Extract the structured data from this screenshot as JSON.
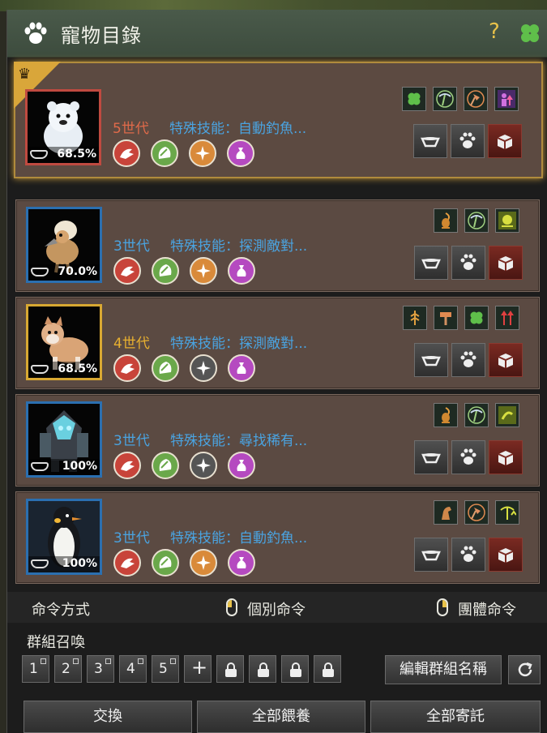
{
  "window": {
    "title": "寵物目錄",
    "help": "?"
  },
  "pets": [
    {
      "generation": "5世代",
      "gen_color": "#e06a4a",
      "skill": "特殊技能：自動釣魚...",
      "feed": "68.5%",
      "frame": "red",
      "leader": true,
      "pet_icon": "polar-bear-icon",
      "commands": [
        "#c8443a",
        "#6aa84a",
        "#d98a3a",
        "#b54ac0"
      ],
      "buffs": [
        "clover-icon",
        "pickaxe-icon",
        "axe-icon",
        "up-arrow-icon"
      ]
    },
    {
      "generation": "3世代",
      "gen_color": "#4aa3e0",
      "skill": "特殊技能：探測敵對...",
      "feed": "70.0%",
      "frame": "blue",
      "leader": false,
      "pet_icon": "hatchling-bird-icon",
      "commands": [
        "#c8443a",
        "#6aa84a",
        "#d98a3a",
        "#b54ac0"
      ],
      "buffs": [
        "scorpion-icon",
        "pickaxe-icon",
        "speed-icon"
      ]
    },
    {
      "generation": "4世代",
      "gen_color": "#e8b030",
      "skill": "特殊技能：探測敵對...",
      "feed": "68.5%",
      "frame": "gold",
      "leader": false,
      "pet_icon": "shiba-dog-icon",
      "commands": [
        "#c8443a",
        "#6aa84a",
        "#555555",
        "#b54ac0"
      ],
      "buffs": [
        "wheat-icon",
        "hammer-icon",
        "clover-icon",
        "double-arrow-icon"
      ]
    },
    {
      "generation": "3世代",
      "gen_color": "#4aa3e0",
      "skill": "特殊技能：尋找稀有...",
      "feed": "100%",
      "frame": "blue",
      "leader": false,
      "pet_icon": "armored-creature-icon",
      "commands": [
        "#c8443a",
        "#6aa84a",
        "#555555",
        "#b54ac0"
      ],
      "buffs": [
        "scorpion-icon",
        "pickaxe-icon",
        "run-icon"
      ]
    },
    {
      "generation": "3世代",
      "gen_color": "#4aa3e0",
      "skill": "特殊技能：自動釣魚...",
      "feed": "100%",
      "frame": "blue",
      "leader": false,
      "pet_icon": "penguin-icon",
      "commands": [
        "#c8443a",
        "#6aa84a",
        "#d98a3a",
        "#b54ac0"
      ],
      "buffs": [
        "horse-icon",
        "axe-icon",
        "pickaxe-up-icon"
      ]
    }
  ],
  "command_mode": {
    "label": "命令方式",
    "individual": "個別命令",
    "group": "團體命令"
  },
  "group_summon": {
    "label": "群組召喚",
    "slots": [
      "1",
      "2",
      "3",
      "4",
      "5"
    ],
    "add": "+",
    "edit": "編輯群組名稱"
  },
  "bottom": {
    "exchange": "交換",
    "feed_all": "全部餵養",
    "deposit_all": "全部寄託"
  }
}
